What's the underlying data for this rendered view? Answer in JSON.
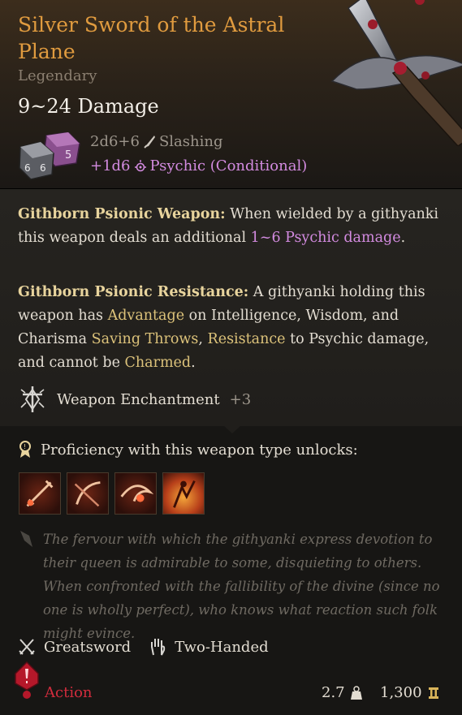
{
  "item": {
    "title": "Silver Sword of the Astral Plane",
    "rarity": "Legendary",
    "damage": "9~24 Damage",
    "roll_primary": "2d6+6",
    "damage_type_primary": "Slashing",
    "roll_bonus": "+1d6",
    "damage_type_bonus": "Psychic (Conditional)",
    "dice_faces": [
      "5",
      "6",
      "6"
    ]
  },
  "passives": {
    "weapon_title": "Githborn Psionic Weapon:",
    "weapon_text_1": " When wielded by a githyanki this weapon deals an additional ",
    "weapon_hl": "1~6 Psychic damage",
    "weapon_text_2": ".",
    "resist_title": "Githborn Psionic Resistance:",
    "resist_text_1": " A githyanki holding this weapon has ",
    "resist_hl_1": "Advantage",
    "resist_text_2": " on Intelligence, Wisdom, and Charisma ",
    "resist_hl_2": "Saving Throws",
    "resist_text_3": ", ",
    "resist_hl_3": "Resistance",
    "resist_text_4": " to Psychic damage, and cannot be ",
    "resist_hl_4": "Charmed",
    "resist_text_5": "."
  },
  "enchantment": {
    "label": "Weapon Enchantment",
    "value": "+3"
  },
  "proficiency": {
    "label": "Proficiency with this weapon type unlocks:",
    "actions": [
      "action-1",
      "action-2",
      "action-3",
      "action-4"
    ]
  },
  "flavor": "The fervour with which the githyanki express devotion to their queen is admirable to some, disquieting to others. When confronted with the fallibility of the divine (since no one is wholly perfect), who knows what reaction such folk might evince.",
  "properties": {
    "type": "Greatsword",
    "handed": "Two-Handed"
  },
  "footer": {
    "action": "Action",
    "weight": "2.7",
    "price": "1,300"
  },
  "colors": {
    "title": "#e09b3f",
    "psychic": "#d38be0",
    "highlight": "#dcc27a",
    "action": "#d12c3d"
  }
}
